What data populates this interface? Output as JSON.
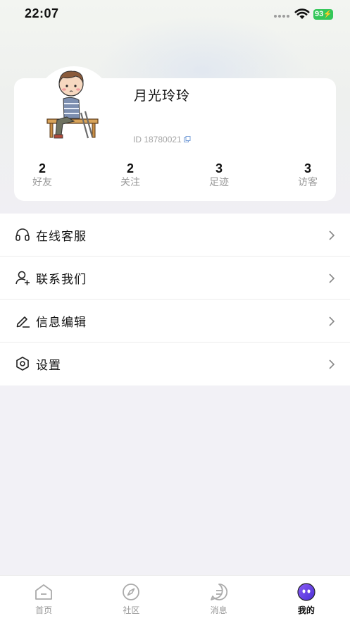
{
  "status_bar": {
    "time": "22:07",
    "battery": "93"
  },
  "profile": {
    "username": "月光玲玲",
    "user_id": "ID 18780021",
    "stats": [
      {
        "value": "2",
        "label": "好友"
      },
      {
        "value": "2",
        "label": "关注"
      },
      {
        "value": "3",
        "label": "足迹"
      },
      {
        "value": "3",
        "label": "访客"
      }
    ]
  },
  "menu": {
    "items": [
      {
        "label": "在线客服",
        "icon": "headset-icon"
      },
      {
        "label": "联系我们",
        "icon": "user-add-icon"
      },
      {
        "label": "信息编辑",
        "icon": "edit-icon"
      },
      {
        "label": "设置",
        "icon": "settings-icon"
      }
    ]
  },
  "tabbar": {
    "tabs": [
      {
        "label": "首页",
        "icon": "home-icon"
      },
      {
        "label": "社区",
        "icon": "compass-icon"
      },
      {
        "label": "消息",
        "icon": "message-icon"
      },
      {
        "label": "我的",
        "icon": "profile-face-icon",
        "active": true
      }
    ]
  },
  "colors": {
    "accent": "#6a3df0",
    "battery": "#34c759",
    "muted": "#999999"
  }
}
